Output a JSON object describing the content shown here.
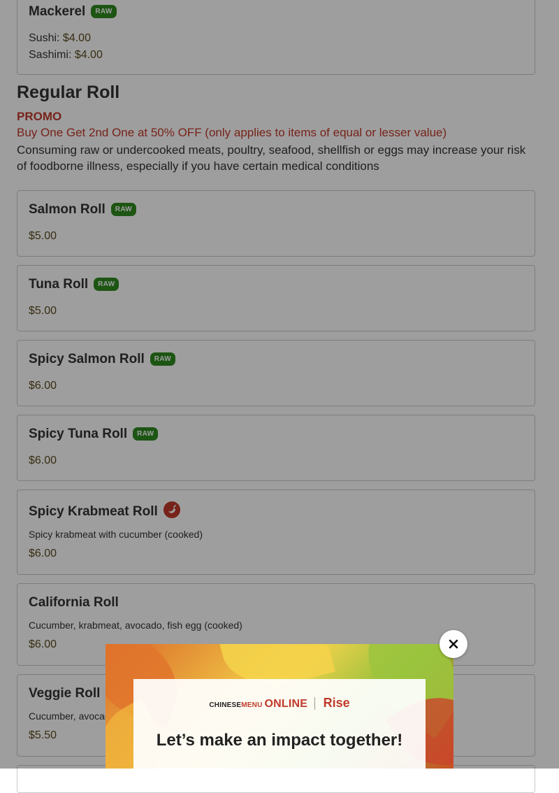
{
  "mackerel": {
    "name": "Mackerel",
    "badge": "RAW",
    "sushi_label": "Sushi:",
    "sushi_price": "$4.00",
    "sashimi_label": "Sashimi:",
    "sashimi_price": "$4.00"
  },
  "section": {
    "title": "Regular Roll",
    "promo_label": "PROMO",
    "promo_text": "Buy One Get 2nd One at 50% OFF (only applies to items of equal or lesser value)",
    "disclaimer": "Consuming raw or undercooked meats, poultry, seafood, shellfish or eggs may increase your risk of foodborne illness, especially if you have certain medical conditions"
  },
  "items": [
    {
      "name": "Salmon Roll",
      "badge": "RAW",
      "price": "$5.00"
    },
    {
      "name": "Tuna Roll",
      "badge": "RAW",
      "price": "$5.00"
    },
    {
      "name": "Spicy Salmon Roll",
      "badge": "RAW",
      "price": "$6.00"
    },
    {
      "name": "Spicy Tuna Roll",
      "badge": "RAW",
      "price": "$6.00"
    },
    {
      "name": "Spicy Krabmeat Roll",
      "icon": "spicy-pepper-icon",
      "description": "Spicy krabmeat with cucumber (cooked)",
      "price": "$6.00"
    },
    {
      "name": "California Roll",
      "description": "Cucumber, krabmeat, avocado, fish egg (cooked)",
      "price": "$6.00"
    },
    {
      "name": "Veggie Roll",
      "description": "Cucumber, avocado",
      "price": "$5.50"
    }
  ],
  "modal": {
    "logo_chinese": "CHINESE",
    "logo_menu": "MENU",
    "logo_online": "ONLINE",
    "logo_rise": "Rise",
    "heading": "Let’s make an impact together!",
    "close_icon": "close-icon"
  },
  "colors": {
    "raw_badge": "#2f8a1f",
    "promo": "#c0392b",
    "price": "#5a4a1e"
  }
}
